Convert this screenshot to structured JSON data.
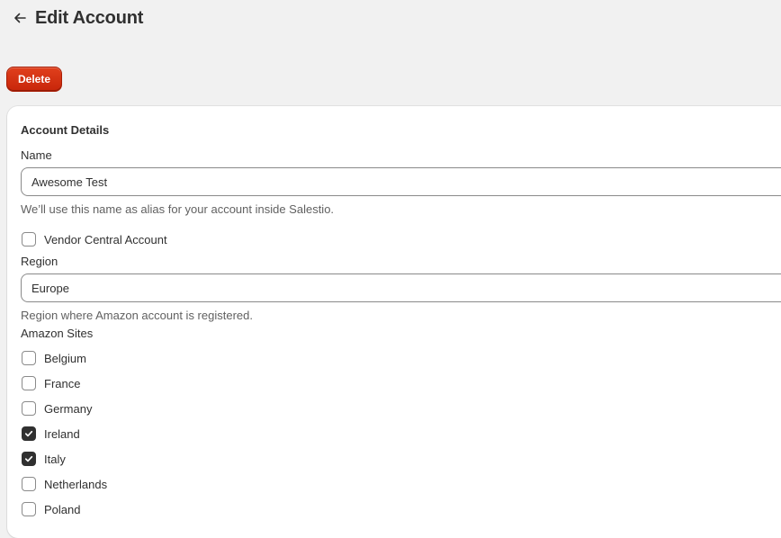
{
  "header": {
    "title": "Edit Account",
    "back_icon": "arrow-left-icon"
  },
  "actions": {
    "delete_label": "Delete",
    "delete_color": "#d72c0d"
  },
  "account_details": {
    "title": "Account Details",
    "name_label": "Name",
    "name_value": "Awesome Test",
    "name_help": "We’ll use this name as alias for your account inside Salestio.",
    "vendor_central_label": "Vendor Central Account",
    "vendor_central_checked": false,
    "region_label": "Region",
    "region_value": "Europe",
    "region_help": "Region where Amazon account is registered.",
    "sites_label": "Amazon Sites",
    "sites": [
      {
        "label": "Belgium",
        "checked": false
      },
      {
        "label": "France",
        "checked": false
      },
      {
        "label": "Germany",
        "checked": false
      },
      {
        "label": "Ireland",
        "checked": true
      },
      {
        "label": "Italy",
        "checked": true
      },
      {
        "label": "Netherlands",
        "checked": false
      },
      {
        "label": "Poland",
        "checked": false
      }
    ]
  }
}
